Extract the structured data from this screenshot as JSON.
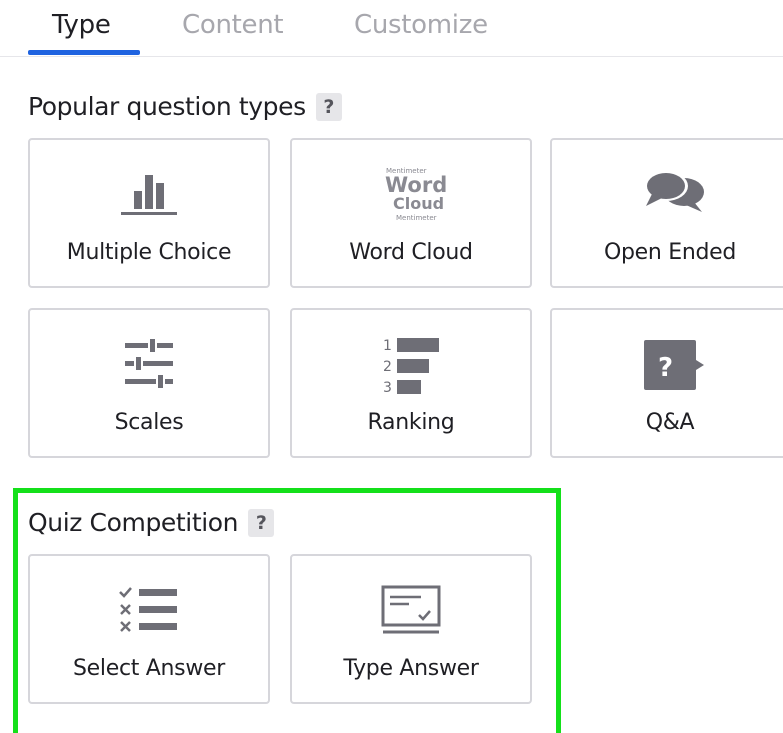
{
  "tabs": [
    {
      "label": "Type",
      "active": true
    },
    {
      "label": "Content",
      "active": false
    },
    {
      "label": "Customize",
      "active": false
    }
  ],
  "popular": {
    "title": "Popular question types",
    "help": "?",
    "cards": [
      {
        "label": "Multiple Choice",
        "icon": "bar-chart-icon"
      },
      {
        "label": "Word Cloud",
        "icon": "word-cloud-icon"
      },
      {
        "label": "Open Ended",
        "icon": "speech-bubbles-icon"
      },
      {
        "label": "Scales",
        "icon": "sliders-icon"
      },
      {
        "label": "Ranking",
        "icon": "ranking-icon"
      },
      {
        "label": "Q&A",
        "icon": "question-bubble-icon"
      }
    ]
  },
  "word_cloud_icon_text": {
    "line1": "Mentimeter",
    "line2": "Word",
    "line3": "Cloud",
    "line4": "Mentimeter"
  },
  "ranking_icon_numbers": [
    "1",
    "2",
    "3"
  ],
  "qa_icon_text": "?",
  "quiz": {
    "title": "Quiz Competition",
    "help": "?",
    "cards": [
      {
        "label": "Select Answer",
        "icon": "checklist-icon"
      },
      {
        "label": "Type Answer",
        "icon": "text-input-icon"
      }
    ]
  },
  "colors": {
    "accent": "#1f63e0",
    "icon_gray": "#6e6e76",
    "highlight": "#14e01a",
    "card_border": "#d6d6db"
  }
}
